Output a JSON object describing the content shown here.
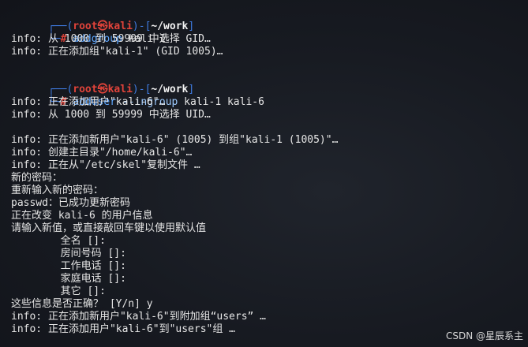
{
  "terminal": {
    "prompt": {
      "open_bracket": "┌──(",
      "user": "root",
      "at_symbol": "㉿",
      "host": "kali",
      "close_bracket": ")-[",
      "cwd": "~/work",
      "cwd_close": "]",
      "second_line": "└─",
      "hash": "#"
    },
    "block1": {
      "command": "addgroup",
      "args": " kali-1",
      "output": [
        "info: 从 1000 到 59999 中选择 GID…",
        "info: 正在添加组\"kali-1\" (GID 1005)…"
      ]
    },
    "block2": {
      "command": "adduser",
      "option": " --ingroup",
      "args": " kali-1 kali-6",
      "output": [
        "info: 正在添加用户\"kali-6\"…",
        "info: 从 1000 到 59999 中选择 UID…",
        "",
        "info: 正在添加新用户\"kali-6\" (1005) 到组\"kali-1 (1005)\"…",
        "info: 创建主目录\"/home/kali-6\"…",
        "info: 正在从\"/etc/skel\"复制文件 …",
        "新的密码：",
        "重新输入新的密码：",
        "passwd：已成功更新密码",
        "正在改变 kali-6 的用户信息",
        "请输入新值，或直接敲回车键以使用默认值",
        "        全名 []:",
        "        房间号码 []:",
        "        工作电话 []:",
        "        家庭电话 []:",
        "        其它 []:",
        "这些信息是否正确？ [Y/n] y",
        "info: 正在添加新用户\"kali-6\"到附加组“users” …",
        "info: 正在添加用户\"kali-6\"到\"users\"组 …"
      ]
    }
  },
  "watermark": "CSDN @星辰系主",
  "colors": {
    "background": "#15181f",
    "prompt_frame": "#3f7be0",
    "prompt_user": "#e0433a",
    "command": "#5fa8ff",
    "text": "#e6e6e6"
  }
}
